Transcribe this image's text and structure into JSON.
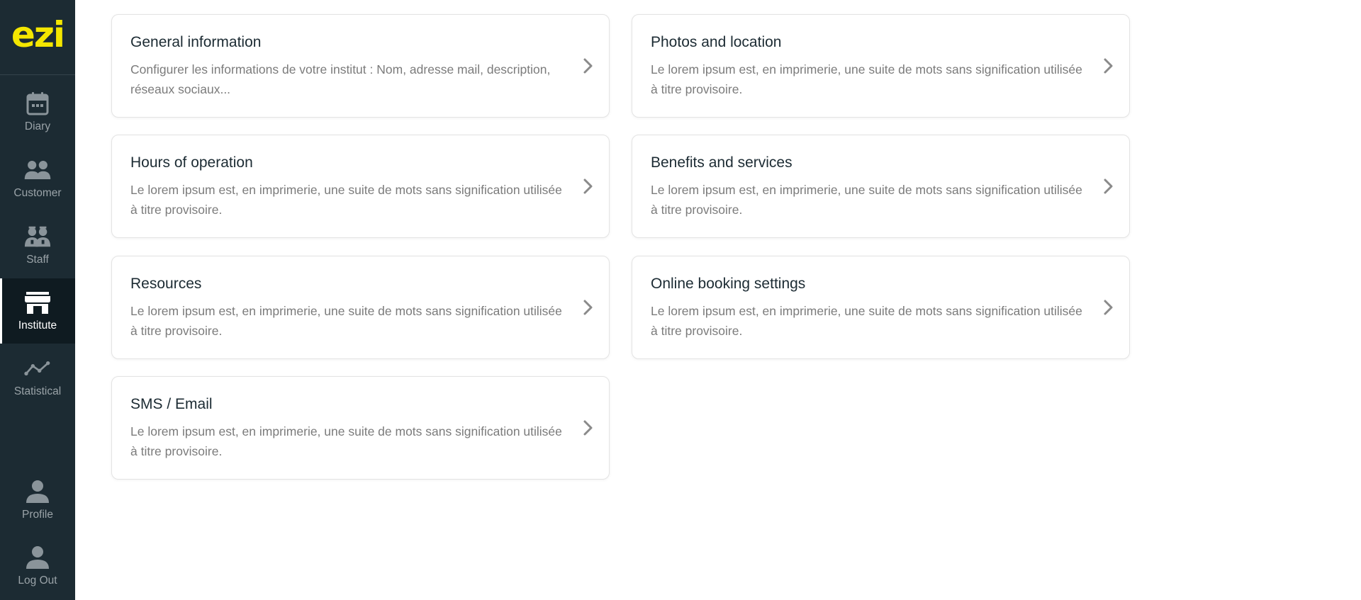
{
  "brand": {
    "logo_text": "ezi",
    "accent": "#f4e600",
    "sidebar_bg": "#1c2b33"
  },
  "sidebar": {
    "items": [
      {
        "label": "Diary",
        "icon": "calendar-icon",
        "active": false
      },
      {
        "label": "Customer",
        "icon": "users-icon",
        "active": false
      },
      {
        "label": "Staff",
        "icon": "staff-icon",
        "active": false
      },
      {
        "label": "Institute",
        "icon": "store-icon",
        "active": true
      },
      {
        "label": "Statistical",
        "icon": "chart-line-icon",
        "active": false
      }
    ],
    "bottom": [
      {
        "label": "Profile",
        "icon": "user-icon"
      },
      {
        "label": "Log Out",
        "icon": "user-icon"
      }
    ]
  },
  "cards": [
    {
      "title": "General information",
      "desc": "Configurer les informations de votre institut : Nom, adresse mail, description, réseaux sociaux..."
    },
    {
      "title": "Photos and location",
      "desc": "Le lorem ipsum est, en imprimerie, une suite de mots sans signification utilisée à titre provisoire."
    },
    {
      "title": "Hours of operation",
      "desc": "Le lorem ipsum est, en imprimerie, une suite de mots sans signification utilisée à titre provisoire."
    },
    {
      "title": "Benefits and services",
      "desc": "Le lorem ipsum est, en imprimerie, une suite de mots sans signification utilisée à titre provisoire."
    },
    {
      "title": "Resources",
      "desc": "Le lorem ipsum est, en imprimerie, une suite de mots sans signification utilisée à titre provisoire."
    },
    {
      "title": "Online booking settings",
      "desc": "Le lorem ipsum est, en imprimerie, une suite de mots sans signification utilisée à titre provisoire."
    },
    {
      "title": "SMS / Email",
      "desc": "Le lorem ipsum est, en imprimerie, une suite de mots sans signification utilisée à titre provisoire."
    }
  ]
}
